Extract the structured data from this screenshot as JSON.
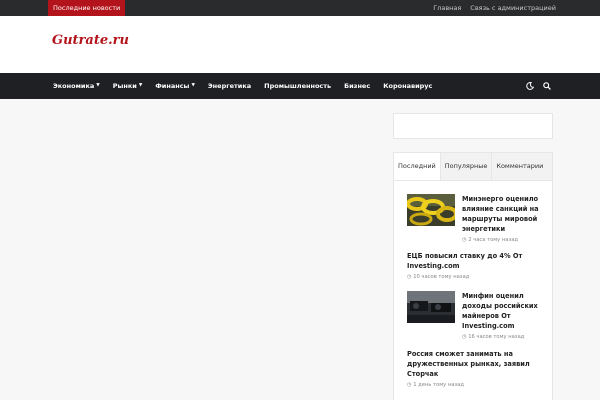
{
  "topbar": {
    "breaking_label": "Последние новости",
    "links": [
      "Главная",
      "Связь с администрацией"
    ]
  },
  "header": {
    "logo": "Gutrate.ru"
  },
  "nav": {
    "items": [
      {
        "label": "Экономика",
        "dropdown": true
      },
      {
        "label": "Рынки",
        "dropdown": true
      },
      {
        "label": "Финансы",
        "dropdown": true
      },
      {
        "label": "Энергетика",
        "dropdown": false
      },
      {
        "label": "Промышленность",
        "dropdown": false
      },
      {
        "label": "Бизнес",
        "dropdown": false
      },
      {
        "label": "Коронавирус",
        "dropdown": false
      }
    ],
    "icons": [
      "moon-icon",
      "search-icon"
    ]
  },
  "sidebar": {
    "tabs": [
      "Последний",
      "Популярные",
      "Комментарии"
    ],
    "active_tab": "Последний",
    "posts": [
      {
        "title": "Минэнерго оценило влияние санкций на маршруты мировой энергетики",
        "time": "2 часа тому назад",
        "thumb": "yellow-pipes"
      },
      {
        "title": "ЕЦБ повысил ставку до 4% От Investing.com",
        "time": "10 часов тому назад",
        "thumb": ""
      },
      {
        "title": "Минфин оценил доходы российских майнеров От Investing.com",
        "time": "16 часов тому назад",
        "thumb": "mining-rigs"
      },
      {
        "title": "Россия сможет занимать на дружественных рынках, заявил Сторчак",
        "time": "1 день тому назад",
        "thumb": ""
      }
    ]
  },
  "colors": {
    "accent": "#b3141c",
    "nav_bg": "#1f2024",
    "topbar_bg": "#2a2b2d"
  }
}
